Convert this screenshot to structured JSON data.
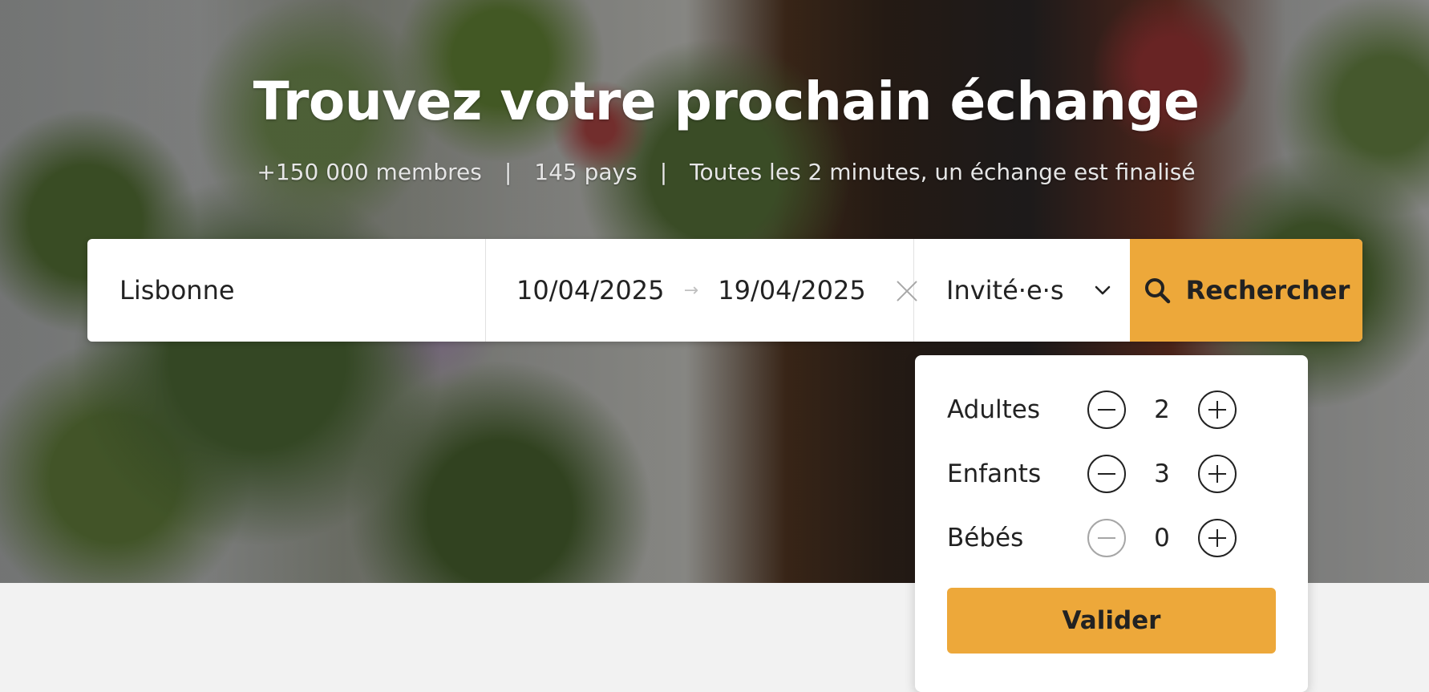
{
  "hero": {
    "title": "Trouvez votre prochain échange",
    "stats": [
      "+150 000 membres",
      "145 pays",
      "Toutes les 2 minutes, un échange est finalisé"
    ],
    "separator": "|"
  },
  "search": {
    "destination": "Lisbonne",
    "date_start": "10/04/2025",
    "date_end": "19/04/2025",
    "guests_label": "Invité·e·s",
    "search_label": "Rechercher",
    "accent_color": "#eda83a"
  },
  "guests": {
    "rows": [
      {
        "label": "Adultes",
        "count": "2",
        "minus_enabled": true
      },
      {
        "label": "Enfants",
        "count": "3",
        "minus_enabled": true
      },
      {
        "label": "Bébés",
        "count": "0",
        "minus_enabled": false
      }
    ],
    "validate_label": "Valider"
  }
}
